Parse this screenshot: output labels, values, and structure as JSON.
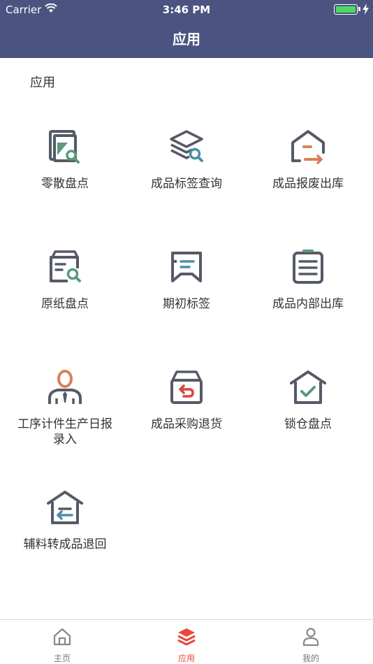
{
  "status": {
    "carrier": "Carrier",
    "time": "3:46 PM",
    "battery_level": 1.0
  },
  "nav": {
    "title": "应用"
  },
  "section": {
    "title": "应用"
  },
  "apps": [
    {
      "label": "零散盘点",
      "icon": "inventory-search-icon"
    },
    {
      "label": "成品标签查询",
      "icon": "layers-search-icon"
    },
    {
      "label": "成品报废出库",
      "icon": "warehouse-scrap-icon"
    },
    {
      "label": "原纸盘点",
      "icon": "box-search-icon"
    },
    {
      "label": "期初标签",
      "icon": "tag-icon"
    },
    {
      "label": "成品内部出库",
      "icon": "clipboard-list-icon"
    },
    {
      "label": "工序计件生产日报录入",
      "icon": "worker-icon"
    },
    {
      "label": "成品采购退货",
      "icon": "box-return-icon"
    },
    {
      "label": "锁仓盘点",
      "icon": "warehouse-check-icon"
    },
    {
      "label": "辅料转成品退回",
      "icon": "warehouse-transfer-icon"
    }
  ],
  "tabbar": {
    "items": [
      {
        "label": "主页",
        "icon": "home-icon",
        "active": false
      },
      {
        "label": "应用",
        "icon": "layers-icon",
        "active": true
      },
      {
        "label": "我的",
        "icon": "user-icon",
        "active": false
      }
    ]
  },
  "colors": {
    "header": "#4b5480",
    "active": "#e8483d",
    "accent_green": "#5a9a7a",
    "accent_orange": "#d9805a",
    "accent_teal": "#4a8fa8",
    "accent_red": "#d9443a"
  }
}
